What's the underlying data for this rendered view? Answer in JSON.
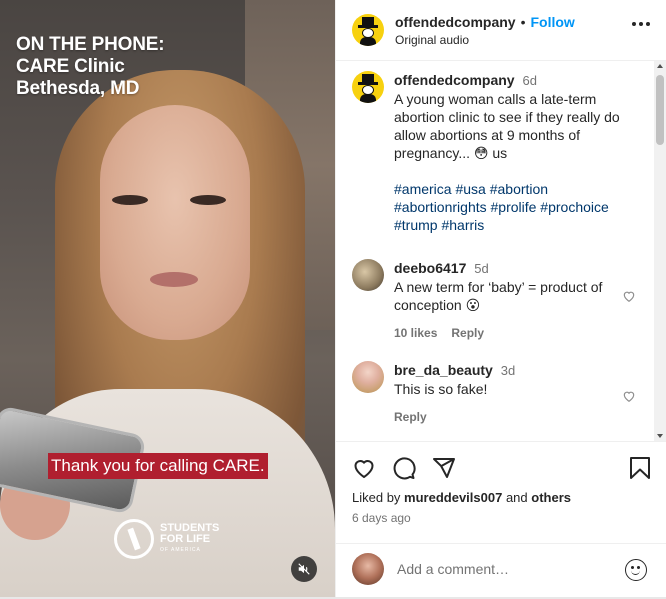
{
  "video": {
    "overlay_title": [
      "ON THE PHONE:",
      "CARE Clinic",
      "Bethesda, MD"
    ],
    "caption": "Thank you for calling CARE.",
    "logo_text": [
      "STUDENTS",
      "FOR LIFE",
      "OF AMERICA"
    ],
    "mute_icon": "speaker-muted-icon"
  },
  "header": {
    "username": "offendedcompany",
    "separator": "•",
    "follow": "Follow",
    "audio": "Original audio",
    "more_icon": "more-options-icon"
  },
  "caption_post": {
    "username": "offendedcompany",
    "time": "6d",
    "text": "A young woman calls a late-term abortion clinic to see if they really do allow abortions at 9 months of pregnancy... 😳 us",
    "hashtags": "#america #usa #abortion #abortionrights #prolife #prochoice #trump #harris"
  },
  "comments": [
    {
      "username": "deebo6417",
      "time": "5d",
      "text": "A new term for ‘baby’ = product of conception 😮",
      "likes": "10 likes",
      "reply": "Reply"
    },
    {
      "username": "bre_da_beauty",
      "time": "3d",
      "text": "This is so fake!",
      "likes": "",
      "reply": "Reply"
    }
  ],
  "actions": {
    "liked_by_prefix": "Liked by",
    "liked_by_user": "mureddevils007",
    "liked_by_and": "and",
    "liked_by_others": "others",
    "date": "6 days ago",
    "add_comment_placeholder": "Add a comment…"
  },
  "colors": {
    "accent": "#0095f6",
    "hashtag": "#00376b",
    "caption_bg": "#b01f2f",
    "avatar_bg": "#f7d10f"
  }
}
